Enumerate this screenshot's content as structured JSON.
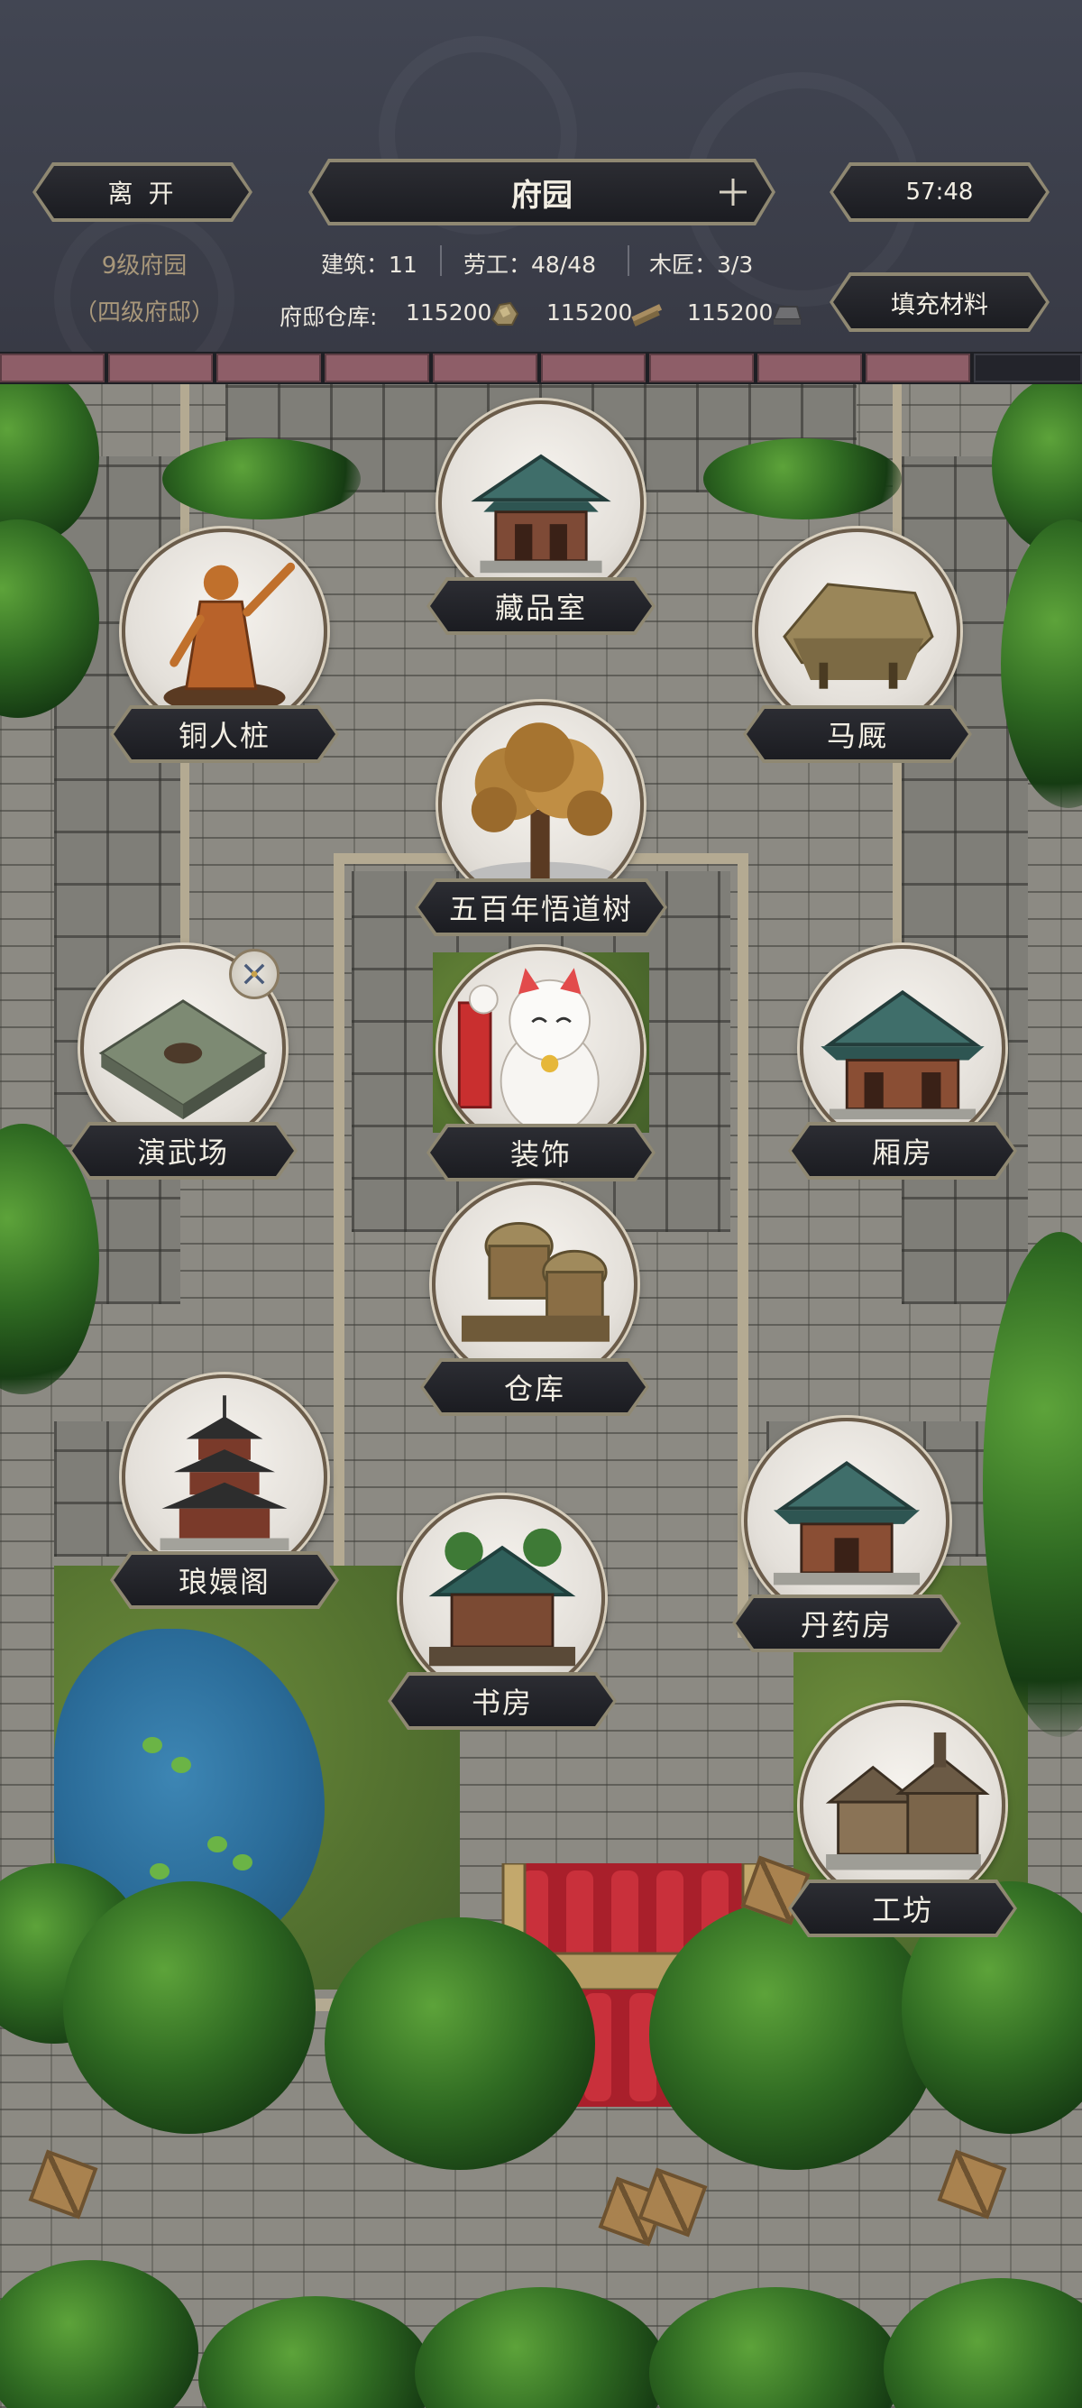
{
  "header": {
    "leave_button": "离 开",
    "title": "府园",
    "timer": "57:48",
    "level": "9级府园",
    "rank": "（四级府邸）",
    "fill_button": "填充材料",
    "stats": {
      "buildings": "建筑：11",
      "labor": "劳工：48/48",
      "carpenter": "木匠：3/3"
    },
    "warehouse": {
      "label": "府邸仓库:",
      "items": [
        {
          "value": "115200",
          "icon": "ore-icon"
        },
        {
          "value": "115200",
          "icon": "timber-icon"
        },
        {
          "value": "115200",
          "icon": "iron-ingot-icon"
        }
      ]
    }
  },
  "progress": {
    "filled_segments": 9
  },
  "buildings": [
    {
      "name": "藏品室",
      "icon": "collection-hall-icon"
    },
    {
      "name": "铜人桩",
      "icon": "bronze-statue-icon"
    },
    {
      "name": "马厩",
      "icon": "stable-icon"
    },
    {
      "name": "五百年悟道树",
      "icon": "enlightenment-tree-icon"
    },
    {
      "name": "演武场",
      "icon": "training-ground-icon"
    },
    {
      "name": "装饰",
      "icon": "lucky-cat-icon"
    },
    {
      "name": "厢房",
      "icon": "wing-room-icon"
    },
    {
      "name": "仓库",
      "icon": "warehouse-icon"
    },
    {
      "name": "琅嬛阁",
      "icon": "pagoda-icon"
    },
    {
      "name": "书房",
      "icon": "study-icon"
    },
    {
      "name": "丹药房",
      "icon": "alchemy-room-icon"
    },
    {
      "name": "工坊",
      "icon": "workshop-icon"
    }
  ],
  "colors": {
    "header_bg": "#3c3f4b",
    "pill_border": "#8f8872",
    "progress_fill": "#8e5e68",
    "stone": "#8c8a83"
  }
}
